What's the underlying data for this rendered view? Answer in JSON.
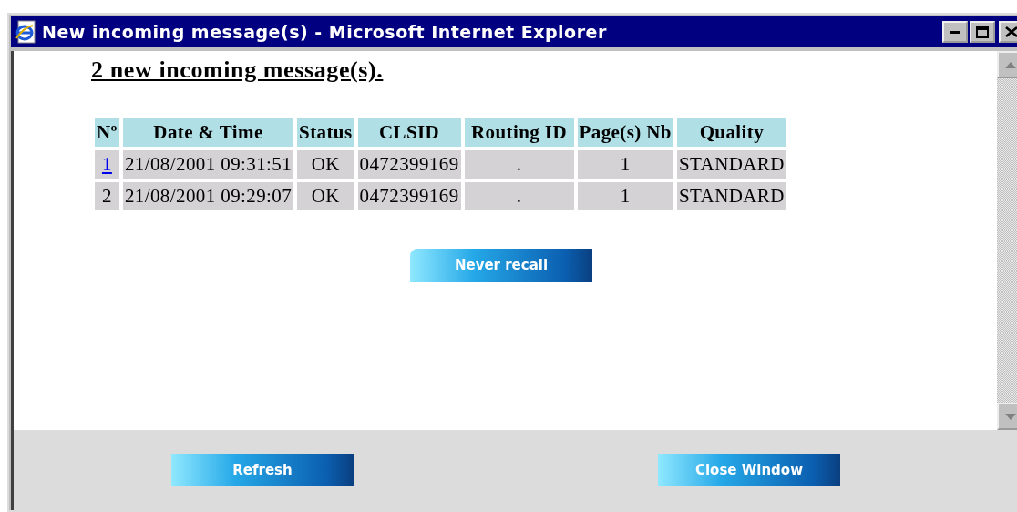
{
  "window": {
    "title": "New incoming message(s) - Microsoft Internet Explorer"
  },
  "heading": "2 new incoming message(s).",
  "table": {
    "columns": [
      "Nº",
      "Date & Time",
      "Status",
      "CLSID",
      "Routing ID",
      "Page(s) Nb",
      "Quality"
    ],
    "rows": [
      {
        "linked": true,
        "cells": [
          "1",
          "21/08/2001 09:31:51",
          "OK",
          "0472399169",
          ".",
          "1",
          "STANDARD"
        ]
      },
      {
        "linked": false,
        "cells": [
          "2",
          "21/08/2001 09:29:07",
          "OK",
          "0472399169",
          ".",
          "1",
          "STANDARD"
        ]
      }
    ]
  },
  "content_button": "Never recall",
  "footer_buttons": [
    "Refresh",
    "Close Window"
  ]
}
